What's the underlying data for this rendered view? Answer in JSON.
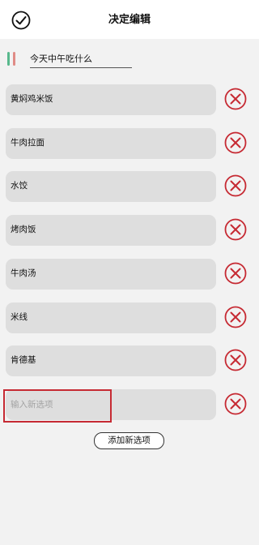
{
  "header": {
    "title": "决定编辑",
    "confirm_icon": "check-circle-icon"
  },
  "title_field": {
    "value": "今天中午吃什么",
    "bar_colors": [
      "#57b88c",
      "#e08b86"
    ]
  },
  "options": [
    {
      "label": "黄焖鸡米饭"
    },
    {
      "label": "牛肉拉面"
    },
    {
      "label": "水饺"
    },
    {
      "label": "烤肉饭"
    },
    {
      "label": "牛肉汤"
    },
    {
      "label": "米线"
    },
    {
      "label": "肯德基"
    }
  ],
  "new_option": {
    "placeholder": "输入新选项"
  },
  "add_button": {
    "label": "添加新选项"
  },
  "delete_icon": "delete-circle-x-icon",
  "colors": {
    "delete_red": "#c62a33",
    "highlight": "#c62a33",
    "field_bg": "#dedede"
  }
}
